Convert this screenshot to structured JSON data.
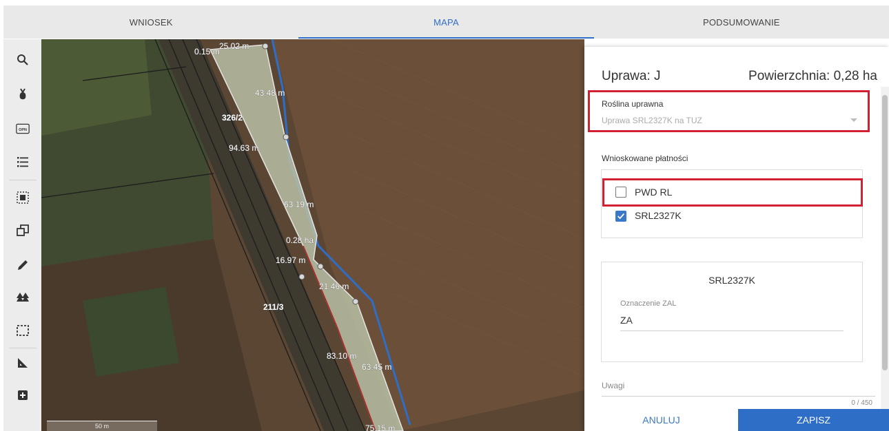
{
  "tabs": [
    {
      "label": "WNIOSEK"
    },
    {
      "label": "MAPA",
      "active": true
    },
    {
      "label": "PODSUMOWANIE"
    }
  ],
  "toolbar": {
    "icons": [
      "search-icon",
      "sprout-icon",
      "opn-icon",
      "list-icon",
      "select-area-icon",
      "copy-shape-icon",
      "pencil-icon",
      "trees-icon",
      "dashed-rect-icon",
      "triangle-ruler-icon",
      "add-box-icon"
    ],
    "opn_text": "OPN"
  },
  "map": {
    "labels": {
      "d1": "0.15 m",
      "d2": "25.02 m",
      "d3": "43.48 m",
      "parcel1": "326/2",
      "d4": "94.63 m",
      "d5": "63.19 m",
      "area": "0.28 ha",
      "d6": "16.97 m",
      "d7": "21.46 m",
      "parcel2": "211/3",
      "d8": "83.10 m",
      "d9": "63.45 m",
      "d10": "75.15 m"
    },
    "scale_label": "50 m"
  },
  "panel": {
    "title": "Uprawa: J",
    "area": "Powierzchnia: 0,28 ha",
    "crop": {
      "label": "Roślina uprawna",
      "value": "Uprawa SRL2327K na TUZ"
    },
    "payments": {
      "label": "Wnioskowane płatności",
      "items": [
        {
          "label": "PWD RL",
          "checked": false
        },
        {
          "label": "SRL2327K",
          "checked": true
        }
      ]
    },
    "card": {
      "title": "SRL2327K",
      "field_label": "Oznaczenie ZAL",
      "field_value": "ZA"
    },
    "notes": {
      "label": "Uwagi",
      "counter": "0 / 450"
    }
  },
  "buttons": {
    "cancel": "ANULUJ",
    "save": "ZAPISZ"
  },
  "colors": {
    "accent": "#2f6ec6",
    "highlight": "#d32030"
  }
}
